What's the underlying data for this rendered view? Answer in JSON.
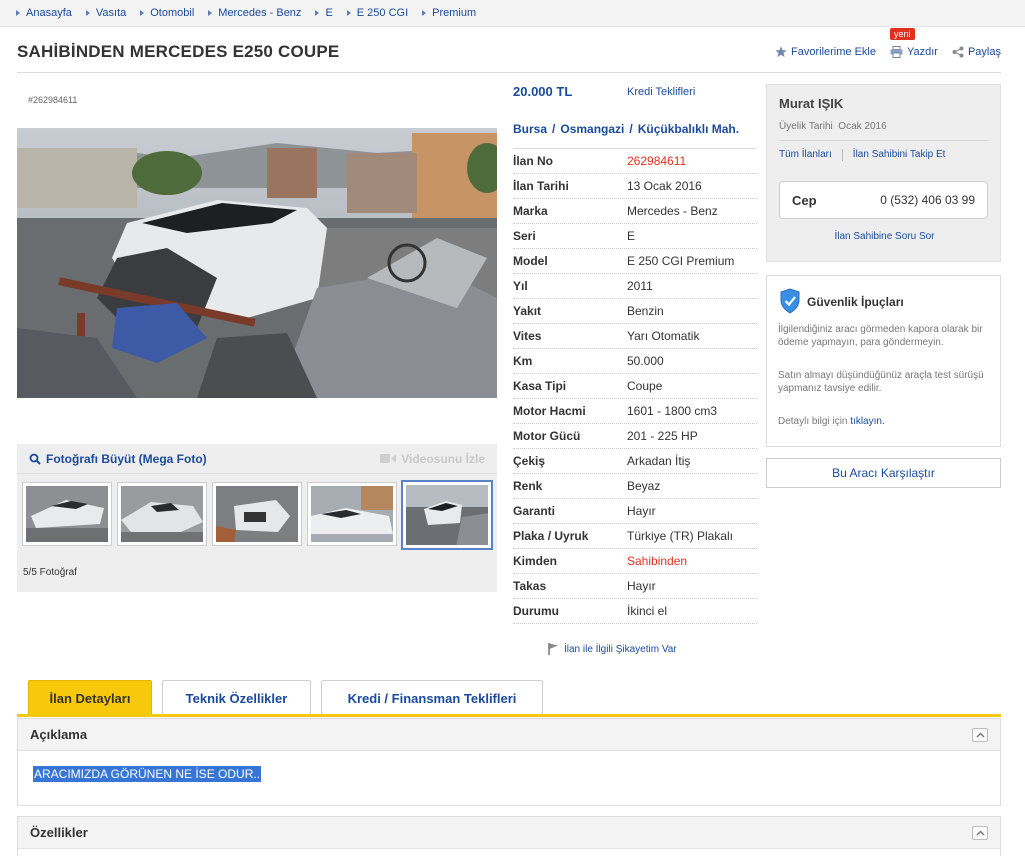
{
  "breadcrumb": [
    "Anasayfa",
    "Vasıta",
    "Otomobil",
    "Mercedes - Benz",
    "E",
    "E 250 CGI",
    "Premium"
  ],
  "title": "SAHİBİNDEN MERCEDES E250 COUPE",
  "actions": {
    "favorite": "Favorilerime Ekle",
    "print": "Yazdır",
    "print_badge": "yeni",
    "share": "Paylaş"
  },
  "listing_id_small": "#262984611",
  "gallery": {
    "mega_photo": "Fotoğrafı Büyüt (Mega Foto)",
    "video": "Videosunu İzle",
    "count": "5/5 Fotoğraf",
    "active_thumb": 5
  },
  "price": "20.000 TL",
  "credit_link": "Kredi Teklifleri",
  "location": [
    "Bursa",
    "Osmangazi",
    "Küçükbalıklı Mah."
  ],
  "details": [
    {
      "key": "İlan No",
      "value": "262984611",
      "highlight": true
    },
    {
      "key": "İlan Tarihi",
      "value": "13 Ocak 2016"
    },
    {
      "key": "Marka",
      "value": "Mercedes - Benz"
    },
    {
      "key": "Seri",
      "value": "E"
    },
    {
      "key": "Model",
      "value": "E 250 CGI Premium"
    },
    {
      "key": "Yıl",
      "value": "2011"
    },
    {
      "key": "Yakıt",
      "value": "Benzin"
    },
    {
      "key": "Vites",
      "value": "Yarı Otomatik"
    },
    {
      "key": "Km",
      "value": "50.000"
    },
    {
      "key": "Kasa Tipi",
      "value": "Coupe"
    },
    {
      "key": "Motor Hacmi",
      "value": "1601 - 1800 cm3"
    },
    {
      "key": "Motor Gücü",
      "value": "201 - 225 HP"
    },
    {
      "key": "Çekiş",
      "value": "Arkadan İtiş"
    },
    {
      "key": "Renk",
      "value": "Beyaz"
    },
    {
      "key": "Garanti",
      "value": "Hayır"
    },
    {
      "key": "Plaka / Uyruk",
      "value": "Türkiye (TR) Plakalı"
    },
    {
      "key": "Kimden",
      "value": "Sahibinden",
      "highlight": true
    },
    {
      "key": "Takas",
      "value": "Hayır"
    },
    {
      "key": "Durumu",
      "value": "İkinci el"
    }
  ],
  "complaint": "İlan ile İlgili Şikayetim Var",
  "seller": {
    "name": "Murat IŞIK",
    "member_since_label": "Üyelik Tarihi",
    "member_since": "Ocak 2016",
    "all_listings": "Tüm İlanları",
    "follow": "İlan Sahibini Takip Et",
    "phone_label": "Cep",
    "phone": "0 (532) 406 03 99",
    "ask": "İlan Sahibine Soru Sor"
  },
  "safety": {
    "title": "Güvenlik İpuçları",
    "p1": "İlgilendiğiniz aracı görmeden kapora olarak bir ödeme yapmayın, para göndermeyin.",
    "p2": "Satın almayı düşündüğünüz araçla test sürüşü yapmanız tavsiye edilir.",
    "p3_prefix": "Detaylı bilgi için ",
    "p3_link": "tıklayın."
  },
  "compare": "Bu Aracı Karşılaştır",
  "tabs": [
    "İlan Detayları",
    "Teknik Özellikler",
    "Kredi / Finansman Teklifleri"
  ],
  "sections": {
    "description_title": "Açıklama",
    "description_text": "ARACIMIZDA GÖRÜNEN NE İSE ODUR..",
    "features_title": "Özellikler"
  },
  "colors": {
    "link": "#1a4a9c",
    "accent_yellow": "#f7c90a",
    "red": "#e0301e"
  }
}
